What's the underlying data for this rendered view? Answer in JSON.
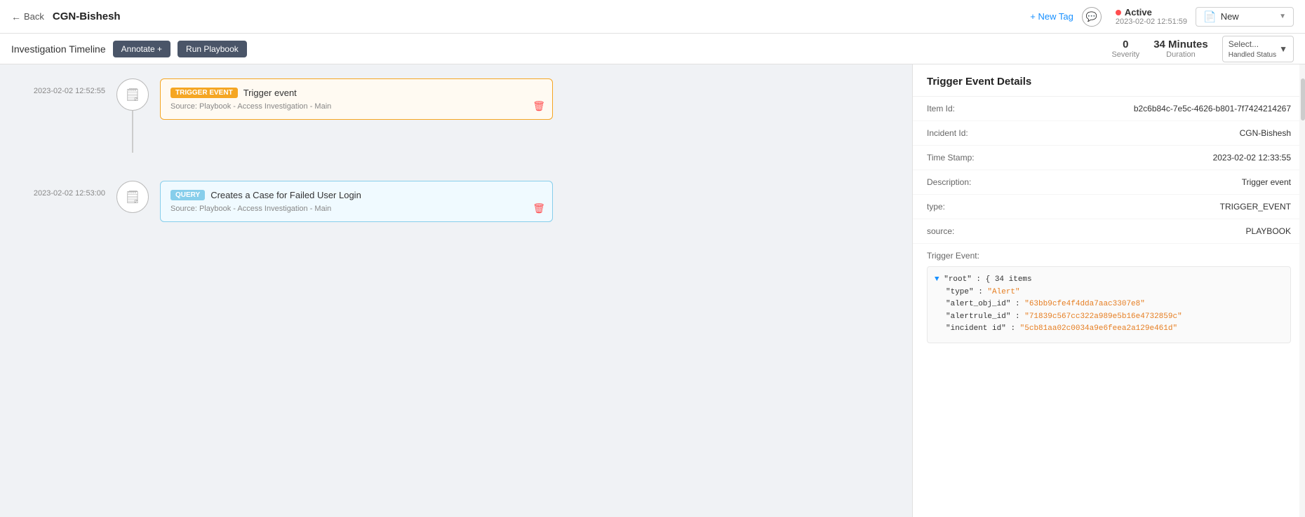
{
  "topbar": {
    "back_label": "Back",
    "incident_title": "CGN-Bishesh",
    "new_tag_label": "+ New Tag",
    "active_label": "Active",
    "active_date": "2023-02-02 12:51:59",
    "new_badge_label": "New",
    "comment_icon": "💬"
  },
  "subbar": {
    "inv_timeline_label": "Investigation Timeline",
    "annotate_label": "Annotate +",
    "run_playbook_label": "Run Playbook",
    "severity_value": "0",
    "severity_label": "Severity",
    "duration_value": "34 Minutes",
    "duration_label": "Duration",
    "handled_status_label": "Select...",
    "handled_status_sublabel": "Handled Status"
  },
  "timeline": {
    "items": [
      {
        "timestamp": "2023-02-02 12:52:55",
        "type": "trigger",
        "badge": "TRIGGER EVENT",
        "title": "Trigger event",
        "source": "Source: Playbook - Access Investigation - Main"
      },
      {
        "timestamp": "2023-02-02 12:53:00",
        "type": "query",
        "badge": "QUERY",
        "title": "Creates a Case for Failed User Login",
        "source": "Source: Playbook - Access Investigation - Main"
      }
    ]
  },
  "details": {
    "header": "Trigger Event Details",
    "fields": [
      {
        "key": "Item Id:",
        "value": "b2c6b84c-7e5c-4626-b801-7f7424214267"
      },
      {
        "key": "Incident Id:",
        "value": "CGN-Bishesh"
      },
      {
        "key": "Time Stamp:",
        "value": "2023-02-02 12:33:55"
      },
      {
        "key": "Description:",
        "value": "Trigger event"
      },
      {
        "key": "type:",
        "value": "TRIGGER_EVENT"
      },
      {
        "key": "source:",
        "value": "PLAYBOOK"
      }
    ],
    "trigger_event_label": "Trigger Event:",
    "json": {
      "root_label": "\"root\" : { 34 items",
      "type_key": "\"type\"",
      "type_val": "\"Alert\"",
      "alert_obj_key": "\"alert_obj_id\"",
      "alert_obj_val": "\"63bb9cfe4f4dda7aac3307e8\"",
      "alertrule_key": "\"alertrule_id\"",
      "alertrule_val": "\"71839c567cc322a989e5b16e4732859c\"",
      "incident_key": "\"incident id\"",
      "incident_val": "\"5cb81aa02c0034a9e6feea2a129e461d\""
    }
  }
}
